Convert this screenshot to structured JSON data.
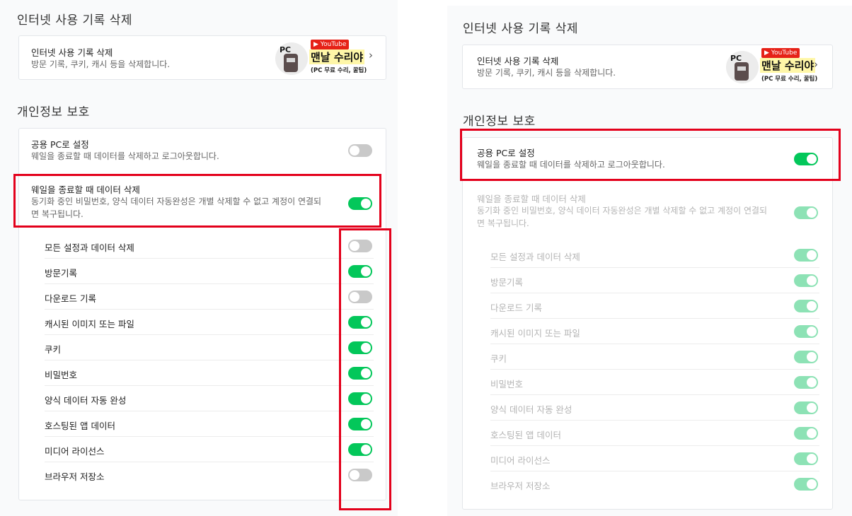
{
  "left": {
    "history_section_title": "인터넷 사용 기록 삭제",
    "history_card": {
      "title": "인터넷 사용 기록 삭제",
      "desc": "방문 기록, 쿠키, 캐시 등을 삭제합니다.",
      "chevron": "›"
    },
    "privacy_section_title": "개인정보 보호",
    "public_pc": {
      "title": "공용 PC로 설정",
      "desc": "웨일을 종료할 때 데이터를 삭제하고 로그아웃합니다.",
      "on": false
    },
    "delete_on_exit": {
      "title": "웨일을 종료할 때 데이터 삭제",
      "desc1": "동기화 중인 비밀번호, 양식 데이터 자동완성은 개별 삭제할 수 없고 계정이 연결되",
      "desc2": "면 복구됩니다.",
      "on": true
    },
    "items": [
      {
        "label": "모든 설정과 데이터 삭제",
        "on": false
      },
      {
        "label": "방문기록",
        "on": true
      },
      {
        "label": "다운로드 기록",
        "on": false
      },
      {
        "label": "캐시된 이미지 또는 파일",
        "on": true
      },
      {
        "label": "쿠키",
        "on": true
      },
      {
        "label": "비밀번호",
        "on": true
      },
      {
        "label": "양식 데이터 자동 완성",
        "on": true
      },
      {
        "label": "호스팅된 앱 데이터",
        "on": true
      },
      {
        "label": "미디어 라이선스",
        "on": true
      },
      {
        "label": "브라우저 저장소",
        "on": false
      }
    ]
  },
  "right": {
    "history_section_title": "인터넷 사용 기록 삭제",
    "history_card": {
      "title": "인터넷 사용 기록 삭제",
      "desc": "방문 기록, 쿠키, 캐시 등을 삭제합니다.",
      "chevron": "›"
    },
    "privacy_section_title": "개인정보 보호",
    "public_pc": {
      "title": "공용 PC로 설정",
      "desc": "웨일을 종료할 때 데이터를 삭제하고 로그아웃합니다.",
      "on": true
    },
    "delete_on_exit": {
      "title": "웨일을 종료할 때 데이터 삭제",
      "desc1": "동기화 중인 비밀번호, 양식 데이터 자동완성은 개별 삭제할 수 없고 계정이 연결되",
      "desc2": "면 복구됩니다.",
      "on": true
    },
    "items": [
      {
        "label": "모든 설정과 데이터 삭제",
        "on": true
      },
      {
        "label": "방문기록",
        "on": true
      },
      {
        "label": "다운로드 기록",
        "on": true
      },
      {
        "label": "캐시된 이미지 또는 파일",
        "on": true
      },
      {
        "label": "쿠키",
        "on": true
      },
      {
        "label": "비밀번호",
        "on": true
      },
      {
        "label": "양식 데이터 자동 완성",
        "on": true
      },
      {
        "label": "호스팅된 앱 데이터",
        "on": true
      },
      {
        "label": "미디어 라이선스",
        "on": true
      },
      {
        "label": "브라우저 저장소",
        "on": true
      }
    ]
  },
  "logo": {
    "pc": "PC",
    "youtube": "▶ YouTube",
    "name": "맨날 수리야",
    "sub": "(PC 무료 수리, 꿀팁)"
  },
  "colors": {
    "toggle_on": "#03c75a",
    "toggle_off": "#c9c9c9",
    "toggle_disabled": "#8de2b5",
    "highlight": "#e3001b"
  }
}
